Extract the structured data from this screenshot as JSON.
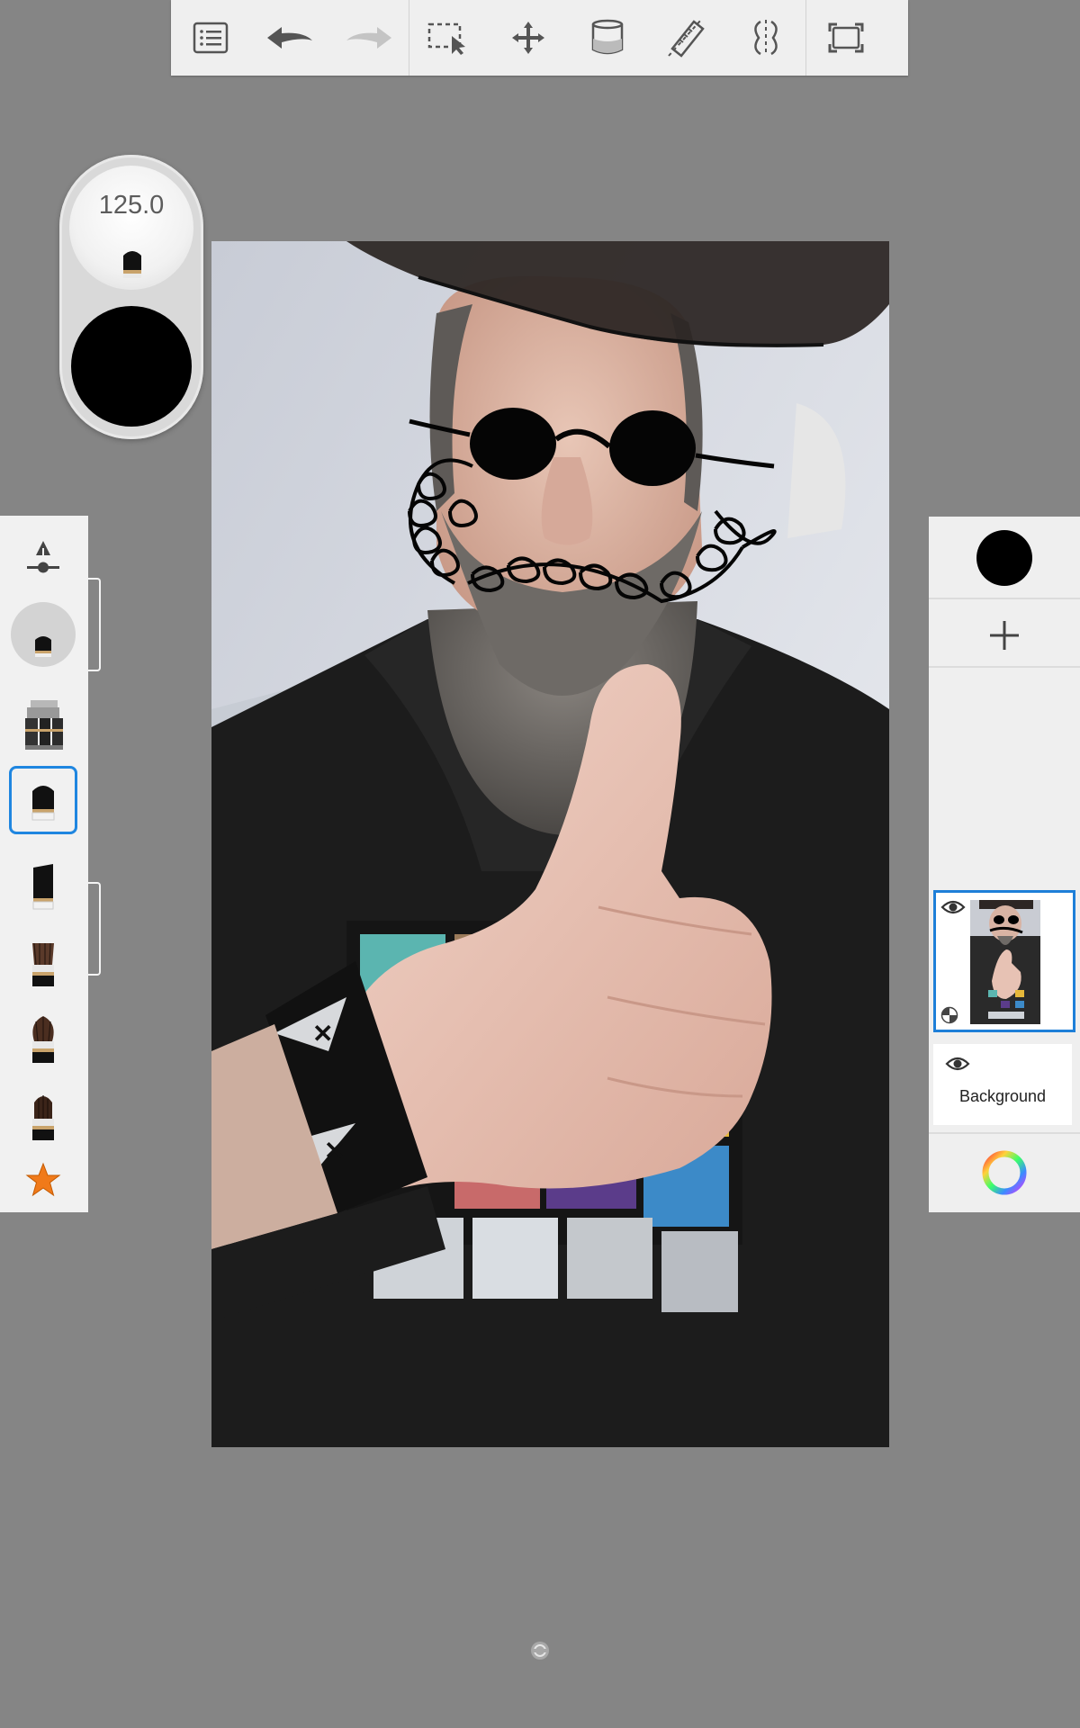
{
  "toolbar": {
    "buttons": [
      {
        "name": "menu-list-icon"
      },
      {
        "name": "undo-icon"
      },
      {
        "name": "redo-icon",
        "disabled": true
      },
      {
        "name": "selection-icon"
      },
      {
        "name": "transform-move-icon"
      },
      {
        "name": "fill-bucket-icon"
      },
      {
        "name": "ruler-guide-icon"
      },
      {
        "name": "symmetry-icon"
      },
      {
        "name": "fullscreen-icon"
      }
    ]
  },
  "brush_puck": {
    "size_value": "125.0",
    "color": "#000000"
  },
  "brush_palette": {
    "items": [
      "brush-settings-icon",
      "current-brush-preview",
      "brush-library-icon",
      "marker-brush-icon",
      "chisel-marker-icon",
      "flat-brush-icon",
      "fan-brush-icon",
      "round-brush-icon",
      "favorites-star-icon"
    ],
    "selected_index": 3
  },
  "layers": {
    "current_color": "#000000",
    "add_layer_icon": "plus-icon",
    "items": [
      {
        "name": "",
        "visible": true,
        "selected": true
      },
      {
        "name": "Background",
        "visible": true,
        "selected": false
      }
    ],
    "color_wheel_icon": "color-wheel-icon"
  },
  "colors": {
    "accent": "#1e7fd8",
    "workspace": "#858585",
    "panel": "#efefef"
  }
}
